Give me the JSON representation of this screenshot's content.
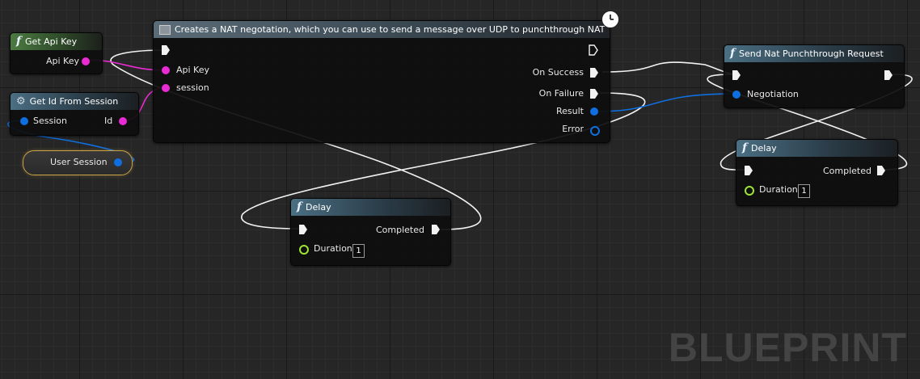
{
  "colors": {
    "exec": "#f2f2f2",
    "string_pin": "#e92bd3",
    "object_pin": "#0f6fe0",
    "float_pin": "#9fe335",
    "selection_outline": "#c9a147"
  },
  "nodes": {
    "get_api_key": {
      "title": "Get Api Key",
      "icon": "function-icon",
      "output": "Api Key"
    },
    "get_id_from_session": {
      "title": "Get Id From Session",
      "icon": "gear-icon",
      "input": "Session",
      "output": "Id"
    },
    "user_session": {
      "label": "User Session"
    },
    "nat_negotiation": {
      "title": "Creates a NAT negotation, which you can use to send a message over UDP to punchthrough NAT",
      "icon": "event-node-icon",
      "badge_icon": "clock-icon",
      "inputs": [
        "Api Key",
        "session"
      ],
      "outputs": [
        "On Success",
        "On Failure",
        "Result",
        "Error"
      ]
    },
    "send_punchthrough": {
      "title": "Send Nat Punchthrough Request",
      "icon": "function-icon",
      "input": "Negotiation"
    },
    "delay_bottom": {
      "title": "Delay",
      "output": "Completed",
      "param": "Duration",
      "value": "1"
    },
    "delay_right": {
      "title": "Delay",
      "output": "Completed",
      "param": "Duration",
      "value": "1"
    }
  },
  "watermark": "BLUEPRINT"
}
